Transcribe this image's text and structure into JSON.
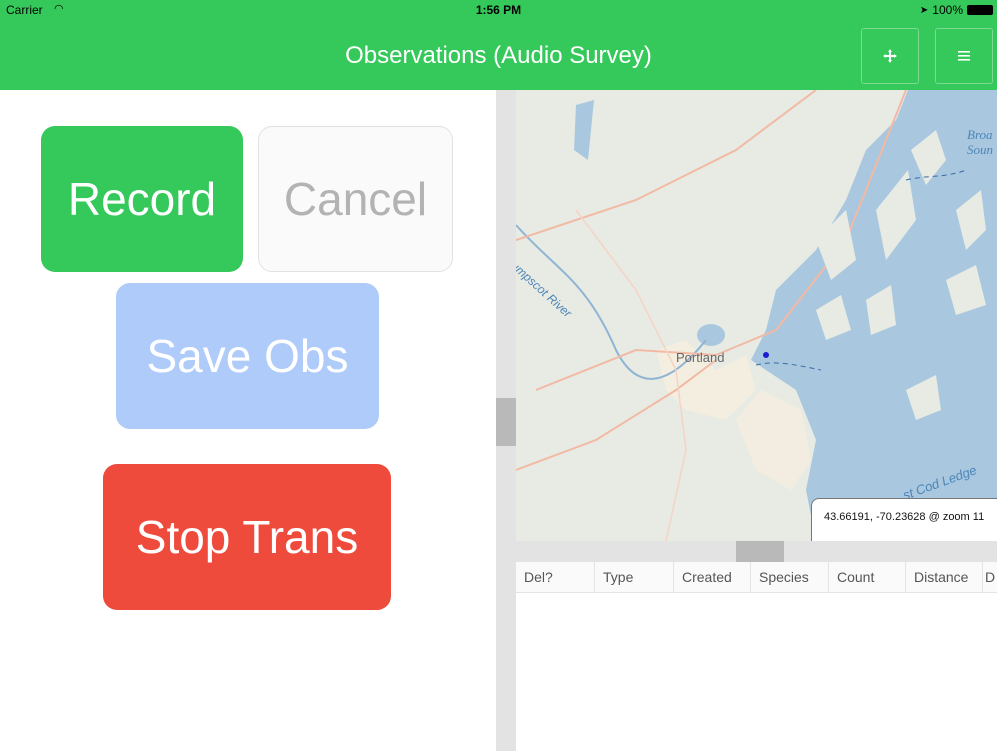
{
  "status_bar": {
    "carrier": "Carrier",
    "time": "1:56 PM",
    "battery": "100%"
  },
  "header": {
    "title": "Observations (Audio Survey)",
    "move_icon": "move-arrows-icon",
    "menu_icon": "hamburger-menu-icon"
  },
  "buttons": {
    "record": "Record",
    "cancel": "Cancel",
    "save": "Save Obs",
    "stop": "Stop Trans"
  },
  "map": {
    "labels": {
      "portland": "Portland",
      "river": "esumpscot River",
      "ledge": "st Cod Ledge",
      "broad": "Broa",
      "sound": "Soun"
    },
    "coordinate_readout": "43.66191, -70.23628 @ zoom 11"
  },
  "table": {
    "columns": [
      "Del?",
      "Type",
      "Created",
      "Species",
      "Count",
      "Distance",
      "D"
    ]
  },
  "colors": {
    "accent": "#35c85a",
    "record": "#35c85a",
    "save": "#aecbfa",
    "stop": "#ef4b3c"
  }
}
